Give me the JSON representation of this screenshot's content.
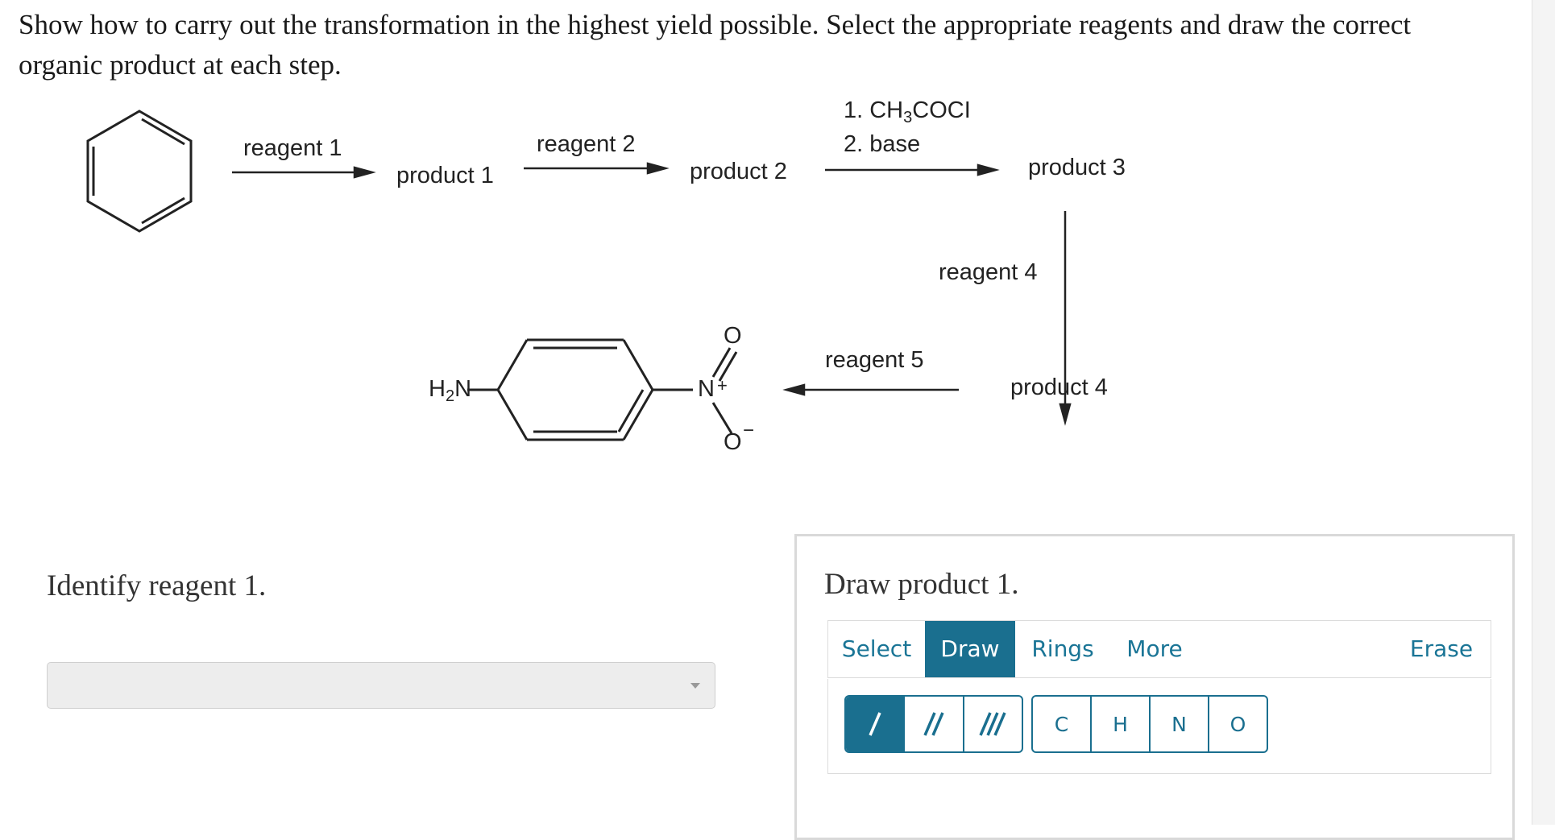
{
  "instructions": "Show how to carry out the transformation in the highest yield possible. Select the appropriate reagents and draw the correct organic product at each step.",
  "scheme": {
    "reagent1": "reagent 1",
    "product1": "product 1",
    "reagent2": "reagent 2",
    "product2": "product 2",
    "step3_line1_pre": "1. CH",
    "step3_line1_sub": "3",
    "step3_line1_post": "COCI",
    "step3_line2": "2. base",
    "product3": "product 3",
    "reagent4": "reagent 4",
    "product4": "product 4",
    "reagent5": "reagent 5",
    "target_amine_h": "H",
    "target_amine_sub": "2",
    "target_amine_n": "N",
    "target_n_plus": "N",
    "target_plus": "+",
    "target_o_top": "O",
    "target_o_bottom": "O",
    "target_minus": "−"
  },
  "left_question": {
    "label": "Identify reagent 1.",
    "dropdown_value": ""
  },
  "draw_panel": {
    "label": "Draw product 1.",
    "tabs": [
      "Select",
      "Draw",
      "Rings",
      "More"
    ],
    "active_tab": "Draw",
    "erase_label": "Erase",
    "bond_buttons": [
      "single-bond",
      "double-bond",
      "triple-bond"
    ],
    "atoms": [
      "C",
      "H",
      "N",
      "O"
    ]
  },
  "colors": {
    "accent": "#1a6f8f",
    "link": "#1a7596"
  }
}
